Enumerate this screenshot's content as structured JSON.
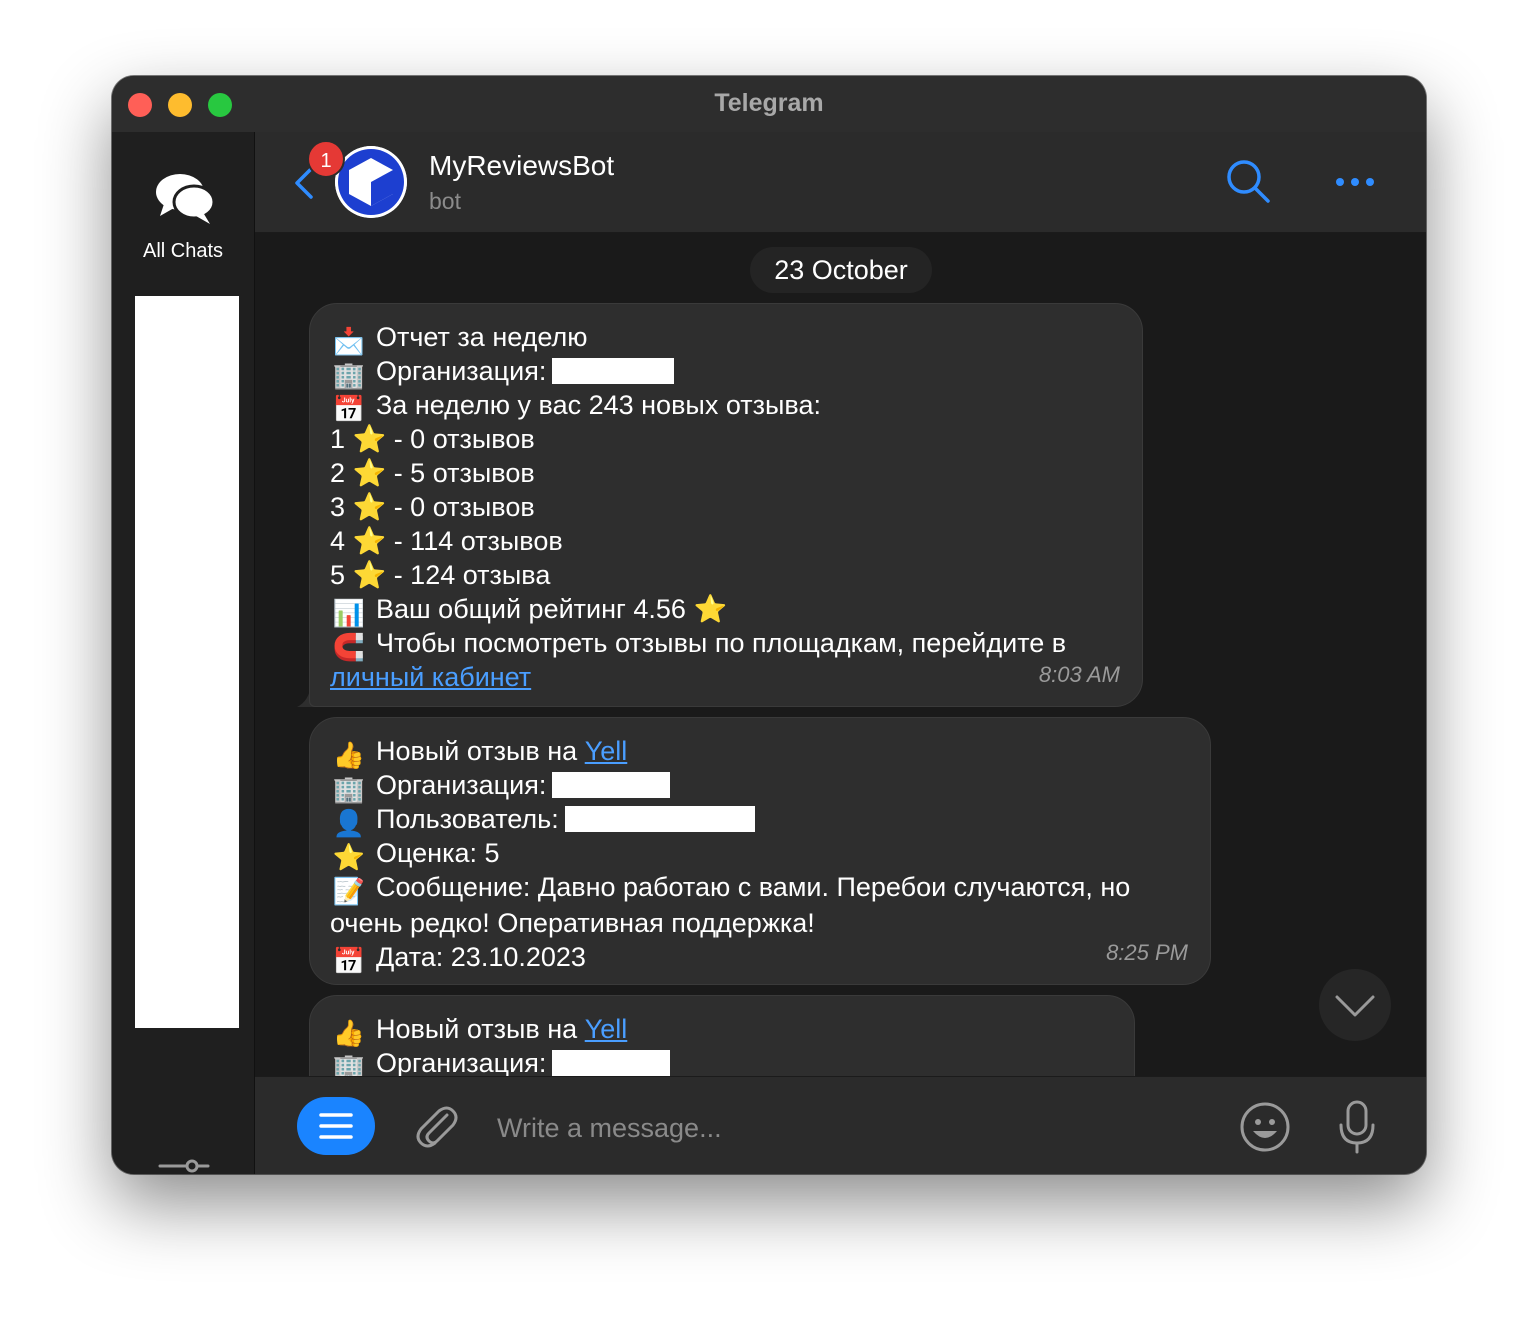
{
  "window": {
    "title": "Telegram"
  },
  "sidebar": {
    "all_chats_label": "All Chats"
  },
  "header": {
    "name": "MyReviewsBot",
    "status": "bot",
    "unread_count": "1"
  },
  "date_separator": "23 October",
  "message1": {
    "line1": "Отчет за неделю",
    "line2": "Организация:",
    "line3": "За неделю у вас 243 новых отзыва:",
    "ratings": [
      {
        "stars": "1",
        "text": "- 0 отзывов"
      },
      {
        "stars": "2",
        "text": "- 5 отзывов"
      },
      {
        "stars": "3",
        "text": "- 0 отзывов"
      },
      {
        "stars": "4",
        "text": "- 114 отзывов"
      },
      {
        "stars": "5",
        "text": "- 124 отзыва"
      }
    ],
    "overall": "Ваш общий рейтинг 4.56",
    "cta": "Чтобы посмотреть отзывы по площадкам, перейдите в",
    "link": "личный кабинет",
    "time": "8:03 AM"
  },
  "message2": {
    "title_prefix": "Новый отзыв на",
    "link": "Yell",
    "org": "Организация:",
    "user": "Пользователь:",
    "rating": "Оценка: 5",
    "message": "Сообщение: Давно работаю с вами. Перебои случаются, но очень редко! Оперативная поддержка!",
    "date": "Дата: 23.10.2023",
    "time": "8:25 PM"
  },
  "message3": {
    "title_prefix": "Новый отзыв на",
    "link": "Yell",
    "org": "Организация:"
  },
  "composer": {
    "placeholder": "Write a message..."
  },
  "colors": {
    "accent": "#1a84ff",
    "link": "#4a9eff",
    "bubble": "#2e2e2e",
    "background": "#1a1a1a"
  }
}
